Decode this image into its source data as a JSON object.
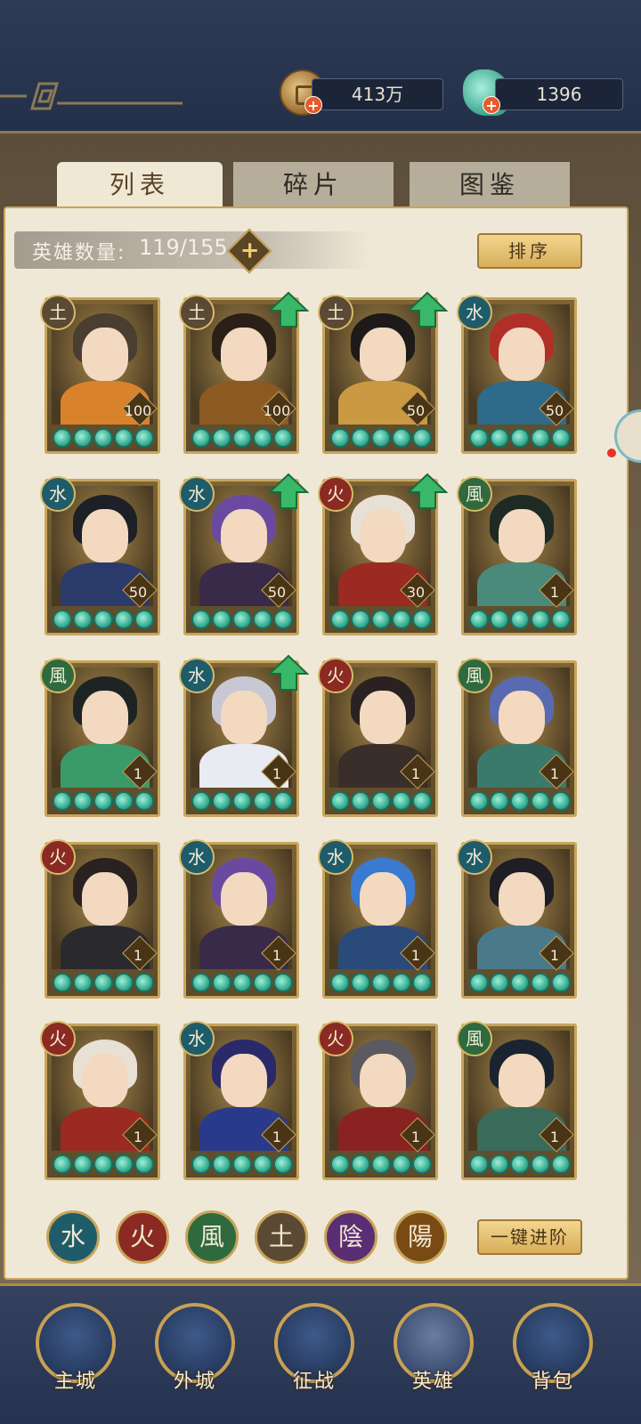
{
  "currency": {
    "coins": "413万",
    "jade": "1396"
  },
  "tabs": [
    {
      "label": "列表",
      "active": true
    },
    {
      "label": "碎片",
      "active": false
    },
    {
      "label": "图鉴",
      "active": false
    }
  ],
  "hero_count": {
    "label": "英雄数量:",
    "value": "119/155"
  },
  "buttons": {
    "sort": "排序",
    "advance_all": "一键进阶"
  },
  "heroes": [
    {
      "element": "土",
      "element_key": "earth",
      "level": "100",
      "upgrade": false,
      "hair": "#4a3e32",
      "body": "#d9822c"
    },
    {
      "element": "土",
      "element_key": "earth",
      "level": "100",
      "upgrade": true,
      "hair": "#2a2018",
      "body": "#8a5a22"
    },
    {
      "element": "土",
      "element_key": "earth",
      "level": "50",
      "upgrade": true,
      "hair": "#1e1a1a",
      "body": "#c99a42"
    },
    {
      "element": "水",
      "element_key": "water",
      "level": "50",
      "upgrade": false,
      "hair": "#b03028",
      "body": "#2e6a8a"
    },
    {
      "element": "水",
      "element_key": "water",
      "level": "50",
      "upgrade": false,
      "hair": "#1e2028",
      "body": "#2a3a6a"
    },
    {
      "element": "水",
      "element_key": "water",
      "level": "50",
      "upgrade": true,
      "hair": "#6a4aa0",
      "body": "#3a2a4a"
    },
    {
      "element": "火",
      "element_key": "fire",
      "level": "30",
      "upgrade": true,
      "hair": "#e8e0d4",
      "body": "#9a2a22"
    },
    {
      "element": "風",
      "element_key": "wind",
      "level": "1",
      "upgrade": false,
      "hair": "#1e2a24",
      "body": "#4a8a7a"
    },
    {
      "element": "風",
      "element_key": "wind",
      "level": "1",
      "upgrade": false,
      "hair": "#1e2424",
      "body": "#3a9a6a"
    },
    {
      "element": "水",
      "element_key": "water",
      "level": "1",
      "upgrade": true,
      "hair": "#c8c8d4",
      "body": "#e8ecf2"
    },
    {
      "element": "火",
      "element_key": "fire",
      "level": "1",
      "upgrade": false,
      "hair": "#2a2222",
      "body": "#3a2e2a"
    },
    {
      "element": "風",
      "element_key": "wind",
      "level": "1",
      "upgrade": false,
      "hair": "#5a6ab0",
      "body": "#3a7a6a"
    },
    {
      "element": "火",
      "element_key": "fire",
      "level": "1",
      "upgrade": false,
      "hair": "#2a2220",
      "body": "#2a2a2e"
    },
    {
      "element": "水",
      "element_key": "water",
      "level": "1",
      "upgrade": false,
      "hair": "#6a4aa0",
      "body": "#3a2a4a"
    },
    {
      "element": "水",
      "element_key": "water",
      "level": "1",
      "upgrade": false,
      "hair": "#3a7ad0",
      "body": "#2a4a7a"
    },
    {
      "element": "水",
      "element_key": "water",
      "level": "1",
      "upgrade": false,
      "hair": "#1e1e24",
      "body": "#4a7a8a"
    },
    {
      "element": "火",
      "element_key": "fire",
      "level": "1",
      "upgrade": false,
      "hair": "#e8e0d4",
      "body": "#9a2a22"
    },
    {
      "element": "水",
      "element_key": "water",
      "level": "1",
      "upgrade": false,
      "hair": "#2a2a6a",
      "body": "#2a3a8a"
    },
    {
      "element": "火",
      "element_key": "fire",
      "level": "1",
      "upgrade": false,
      "hair": "#5a5a60",
      "body": "#8a2222"
    },
    {
      "element": "風",
      "element_key": "wind",
      "level": "1",
      "upgrade": false,
      "hair": "#1a2430",
      "body": "#3a6a5a"
    }
  ],
  "element_filters": [
    {
      "label": "水",
      "key": "water"
    },
    {
      "label": "火",
      "key": "fire"
    },
    {
      "label": "風",
      "key": "wind"
    },
    {
      "label": "土",
      "key": "earth"
    },
    {
      "label": "陰",
      "key": "yin"
    },
    {
      "label": "陽",
      "key": "yang"
    }
  ],
  "nav": [
    {
      "label": "主城",
      "active": false
    },
    {
      "label": "外城",
      "active": false
    },
    {
      "label": "征战",
      "active": false
    },
    {
      "label": "英雄",
      "active": true
    },
    {
      "label": "背包",
      "active": false
    }
  ],
  "colors": {
    "star": "#2aa387",
    "upgrade_arrow": "#3ab86a",
    "gold_border": "#c9a45a"
  }
}
